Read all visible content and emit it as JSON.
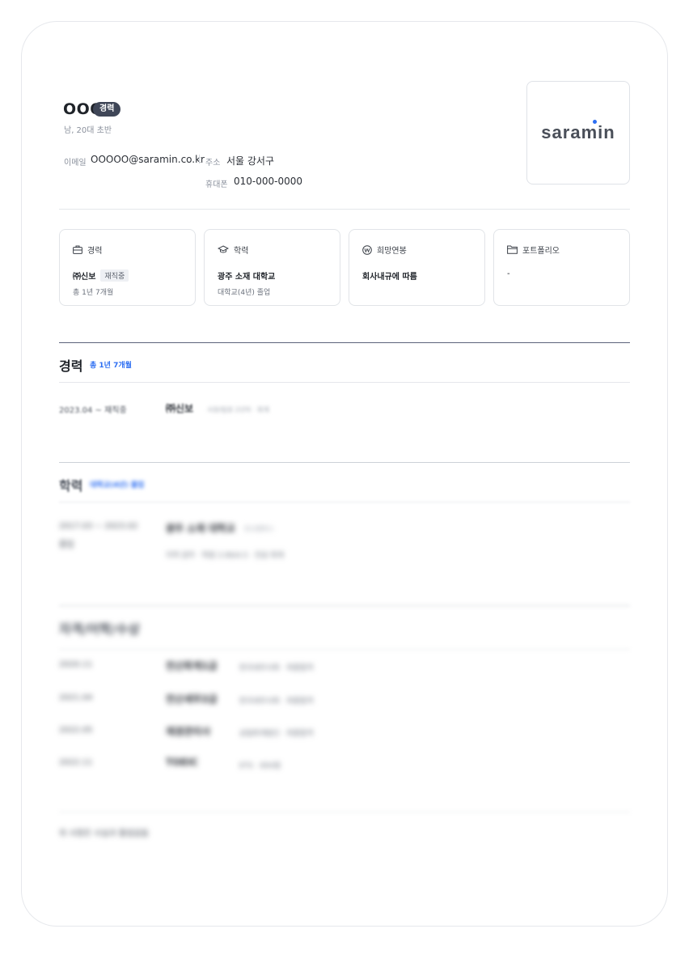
{
  "profile": {
    "name": "OOO",
    "badge": "경력",
    "gender_age": "남, 20대 초반",
    "email_label": "이메일",
    "email": "OOOOO@saramin.co.kr",
    "address_label": "주소",
    "address": "서울 강서구",
    "phone_label": "휴대폰",
    "phone": "010-000-0000",
    "logo_text": "saramin"
  },
  "summary": [
    {
      "icon": "briefcase-icon",
      "title": "경력",
      "main": "㈜신보",
      "tag": "재직중",
      "sub": "총 1년 7개월"
    },
    {
      "icon": "graduation-cap-icon",
      "title": "학력",
      "main": "광주 소재 대학교",
      "tag": "",
      "sub": "대학교(4년) 졸업"
    },
    {
      "icon": "won-icon",
      "title": "희망연봉",
      "main": "회사내규에 따름",
      "tag": "",
      "sub": ""
    },
    {
      "icon": "folder-icon",
      "title": "포트폴리오",
      "main": "-",
      "tag": "",
      "sub": ""
    }
  ],
  "career": {
    "title": "경력",
    "total": "총 1년 7개월",
    "rows": [
      {
        "period": "2023.04 ~ 재직중",
        "company": "㈜신보",
        "detail": "사원/팀원 2년차 · 회계"
      }
    ]
  },
  "education": {
    "title": "학력",
    "note": "대학교(4년) 졸업",
    "rows": [
      {
        "period": "2017.03 ~ 2023.02",
        "status": "졸업",
        "school": "광주 소재 대학교",
        "school_note": "본교캠퍼스",
        "details": "지역 광주 · 학점 3.99/4.5 · 전공 회계"
      }
    ]
  },
  "certs": {
    "title": "자격/어학/수상",
    "rows": [
      {
        "date": "2020.11",
        "name": "전산회계1급",
        "detail": "한국세무사회 · 최종합격"
      },
      {
        "date": "2021.04",
        "name": "전산세무2급",
        "detail": "한국세무사회 · 최종합격"
      },
      {
        "date": "2022.05",
        "name": "재경관리사",
        "detail": "삼일회계법인 · 최종합격"
      },
      {
        "date": "2022.11",
        "name": "TOEIC",
        "detail": "ETS · 850점"
      }
    ]
  },
  "footer": {
    "text": "위 사항은 사실과 틀림없음"
  }
}
